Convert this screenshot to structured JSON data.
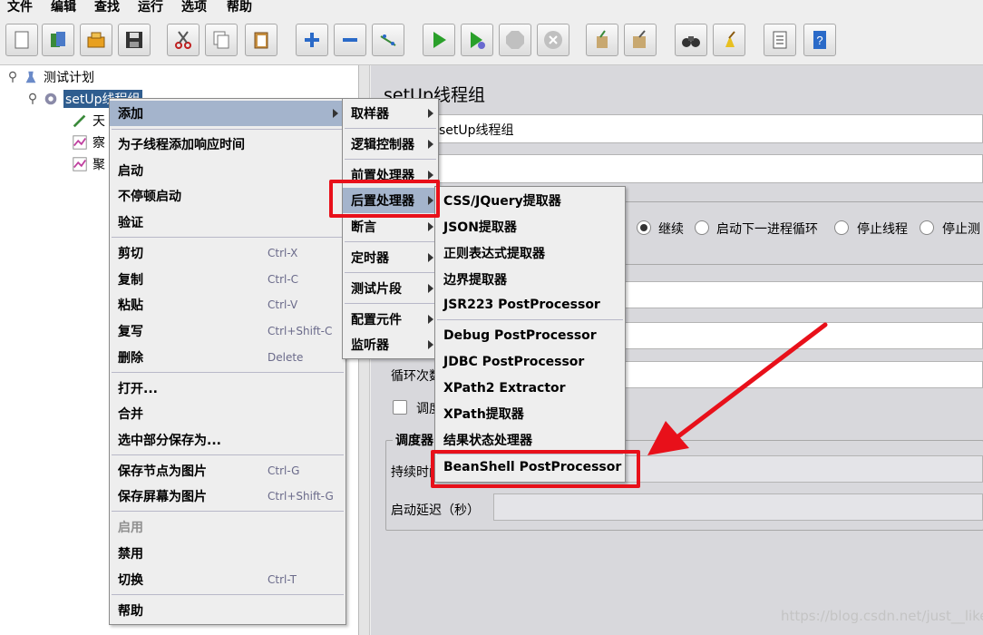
{
  "menubar": {
    "items": [
      "文件",
      "编辑",
      "查找",
      "运行",
      "选项",
      "帮助"
    ]
  },
  "toolbar": {
    "buttons": [
      "new-icon",
      "templates-icon",
      "open-icon",
      "save-icon",
      "cut-icon",
      "copy-icon",
      "paste-icon",
      "expand-icon",
      "collapse-icon",
      "toggle-icon",
      "start-icon",
      "start-no-pause-icon",
      "stop-icon",
      "shutdown-icon",
      "clear-icon",
      "clear-all-icon",
      "search-icon",
      "reset-search-icon",
      "function-helper-icon",
      "help-icon"
    ]
  },
  "tree": {
    "root": "测试计划",
    "thread_group": "setUp线程组",
    "children": [
      "天",
      "察",
      "聚"
    ]
  },
  "right_panel": {
    "title": "setUp线程组",
    "name_value": "setUp线程组",
    "radio_continue": "继续",
    "radio_next_loop": "启动下一进程循环",
    "radio_stop_thread": "停止线程",
    "radio_stop_test": "停止测",
    "loop_label": "循环次数",
    "scheduler_check_label": "调度",
    "scheduler_group_label": "调度器",
    "duration_label": "持续时间",
    "startup_delay_label": "启动延迟（秒）"
  },
  "context_menu": {
    "items": [
      {
        "label": "添加",
        "shortcut": "",
        "submenu": true
      },
      {
        "label": "为子线程添加响应时间",
        "shortcut": ""
      },
      {
        "label": "启动",
        "shortcut": ""
      },
      {
        "label": "不停顿启动",
        "shortcut": ""
      },
      {
        "label": "验证",
        "shortcut": ""
      },
      {
        "label": "剪切",
        "shortcut": "Ctrl-X"
      },
      {
        "label": "复制",
        "shortcut": "Ctrl-C"
      },
      {
        "label": "粘贴",
        "shortcut": "Ctrl-V"
      },
      {
        "label": "复写",
        "shortcut": "Ctrl+Shift-C"
      },
      {
        "label": "删除",
        "shortcut": "Delete"
      },
      {
        "label": "打开...",
        "shortcut": ""
      },
      {
        "label": "合并",
        "shortcut": ""
      },
      {
        "label": "选中部分保存为...",
        "shortcut": ""
      },
      {
        "label": "保存节点为图片",
        "shortcut": "Ctrl-G"
      },
      {
        "label": "保存屏幕为图片",
        "shortcut": "Ctrl+Shift-G"
      },
      {
        "label": "启用",
        "shortcut": ""
      },
      {
        "label": "禁用",
        "shortcut": ""
      },
      {
        "label": "切换",
        "shortcut": "Ctrl-T"
      },
      {
        "label": "帮助",
        "shortcut": ""
      }
    ]
  },
  "add_submenu": {
    "items": [
      "取样器",
      "逻辑控制器",
      "前置处理器",
      "后置处理器",
      "断言",
      "定时器",
      "测试片段",
      "配置元件",
      "监听器"
    ]
  },
  "post_processor_submenu": {
    "items": [
      "CSS/JQuery提取器",
      "JSON提取器",
      "正则表达式提取器",
      "边界提取器",
      "JSR223 PostProcessor",
      "Debug PostProcessor",
      "JDBC PostProcessor",
      "XPath2 Extractor",
      "XPath提取器",
      "结果状态处理器",
      "BeanShell PostProcessor"
    ]
  },
  "annotation": {
    "highlight_color": "#e8101a"
  },
  "watermark": "https://blog.csdn.net/just__like"
}
